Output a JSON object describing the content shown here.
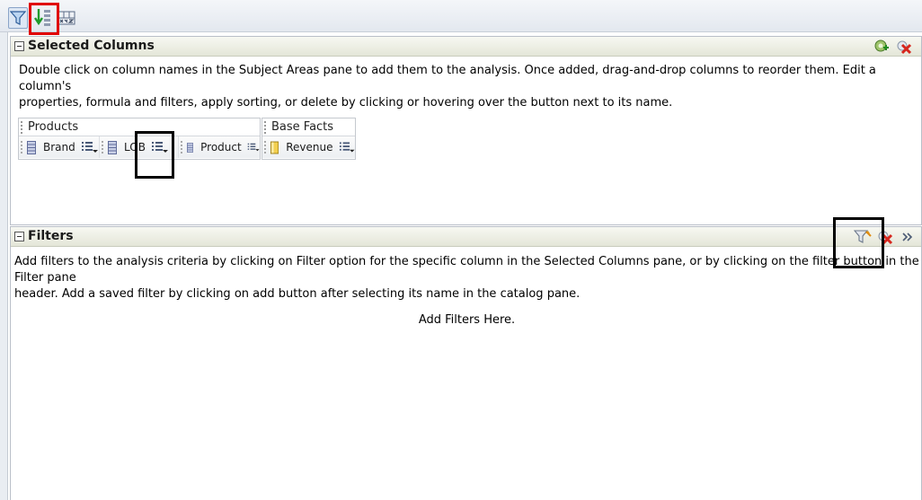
{
  "toolbar": {
    "buttons": [
      {
        "icon": "filter-icon"
      },
      {
        "icon": "sort-icon"
      },
      {
        "icon": "xyz-icon"
      }
    ]
  },
  "selected_columns": {
    "title": "Selected Columns",
    "description_line1": "Double click on column names in the Subject Areas pane to add them to the analysis. Once added, drag-and-drop columns to reorder them. Edit a column's",
    "description_line2": "properties, formula and filters, apply sorting, or delete by clicking or hovering over the button next to its name.",
    "header_icons": [
      "add-column-icon",
      "remove-all-icon"
    ],
    "groups": [
      {
        "title": "Products",
        "columns": [
          "Brand",
          "LOB",
          "Product"
        ]
      },
      {
        "title": "Base Facts",
        "columns": [
          "Revenue"
        ]
      }
    ]
  },
  "filters": {
    "title": "Filters",
    "description_line1": "Add filters to the analysis criteria by clicking on Filter option for the specific column in the Selected Columns pane, or by clicking on the filter button in the Filter pane",
    "description_line2": "header. Add a saved filter by clicking on add button after selecting its name in the catalog pane.",
    "empty_message": "Add Filters Here.",
    "header_icons": [
      "add-filter-icon",
      "remove-filters-icon",
      "expand-icon"
    ]
  },
  "colors": {
    "callout_red": "#e00000",
    "callout_black": "#000000",
    "attribute_icon": "#7a86b8",
    "measure_icon": "#e5b93a"
  }
}
